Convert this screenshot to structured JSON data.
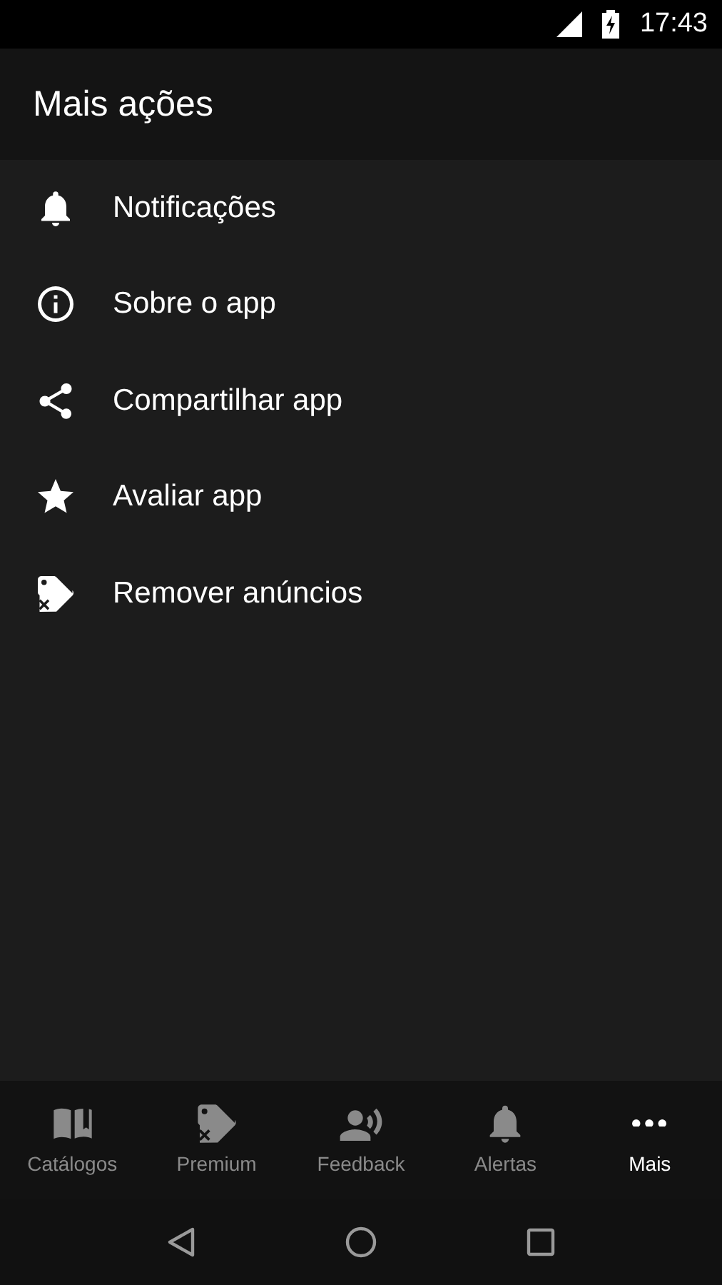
{
  "status_bar": {
    "time": "17:43"
  },
  "app_bar": {
    "title": "Mais ações"
  },
  "menu": [
    {
      "label": "Notificações",
      "kind": "bell"
    },
    {
      "label": "Sobre o app",
      "kind": "info"
    },
    {
      "label": "Compartilhar app",
      "kind": "share"
    },
    {
      "label": "Avaliar app",
      "kind": "star"
    },
    {
      "label": "Remover anúncios",
      "kind": "tag"
    }
  ],
  "bottom_nav": [
    {
      "label": "Catálogos",
      "kind": "book",
      "selected": false
    },
    {
      "label": "Premium",
      "kind": "tag",
      "selected": false
    },
    {
      "label": "Feedback",
      "kind": "speaker",
      "selected": false
    },
    {
      "label": "Alertas",
      "kind": "bell",
      "selected": false
    },
    {
      "label": "Mais",
      "kind": "dots",
      "selected": true
    }
  ]
}
